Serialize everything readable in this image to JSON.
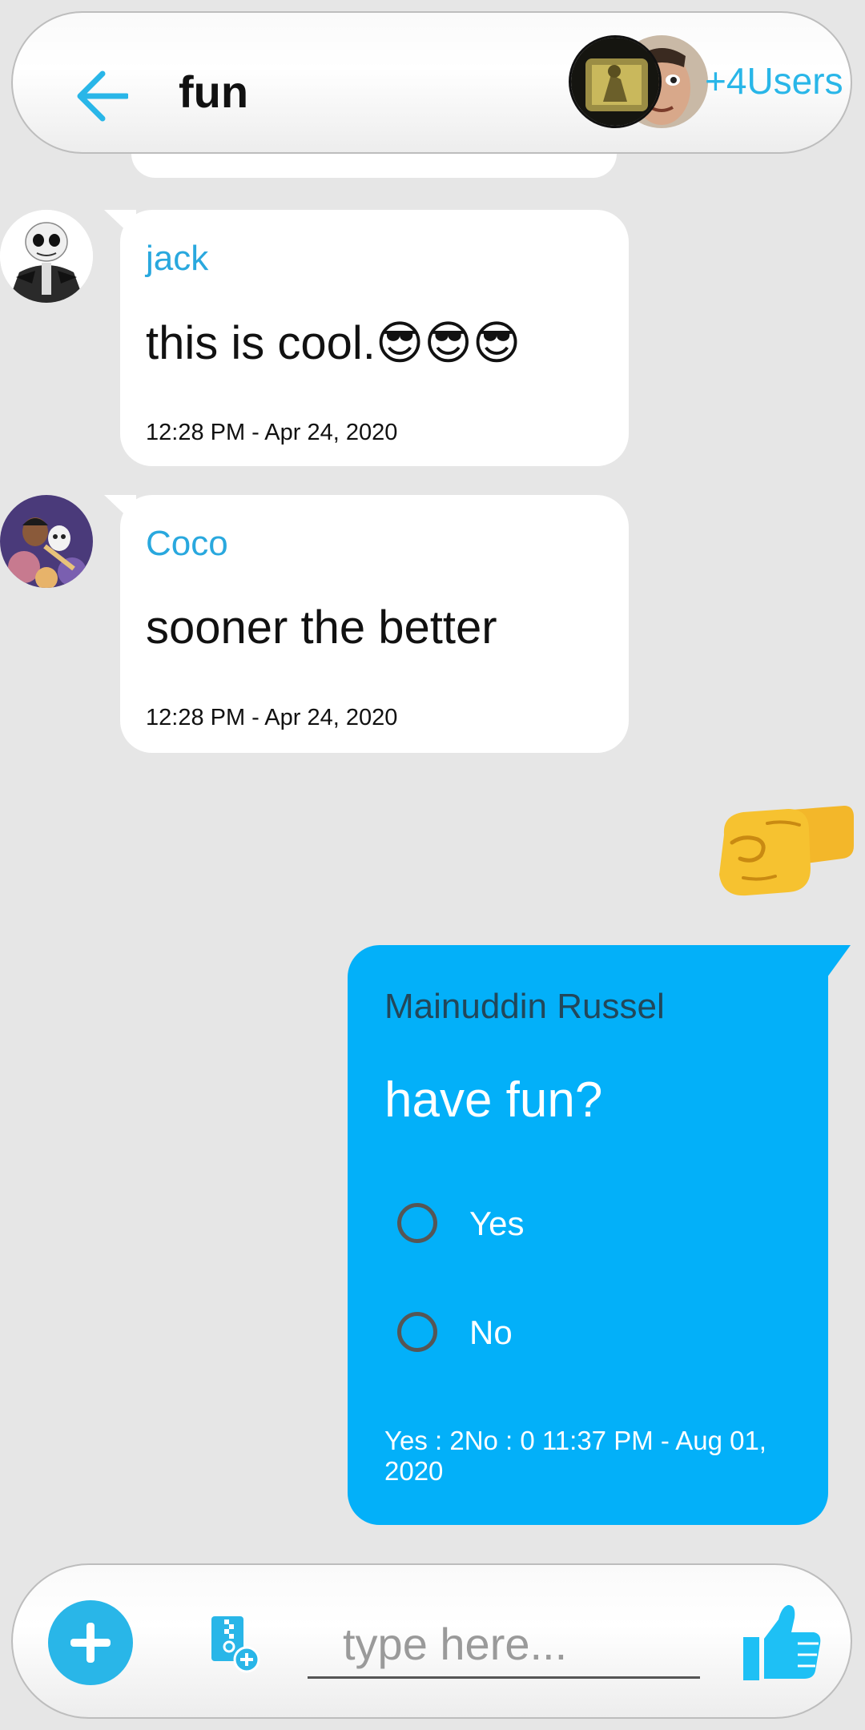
{
  "header": {
    "title": "fun",
    "member_count_label": "+4Users",
    "back_icon": "arrow-left-icon",
    "accent_color": "#29b6e8"
  },
  "messages": [
    {
      "sender": "jack",
      "text": "this is cool.😎😎😎",
      "time": "12:28 PM - Apr 24, 2020",
      "avatar": "skeleton-avatar"
    },
    {
      "sender": "Coco",
      "text": "sooner the better",
      "time": "12:28 PM - Apr 24, 2020",
      "avatar": "coco-avatar"
    }
  ],
  "sticker": {
    "icon": "fist-bump-emoji"
  },
  "poll": {
    "sender": "Mainuddin Russel",
    "question": "have fun?",
    "options": [
      {
        "label": "Yes"
      },
      {
        "label": "No"
      }
    ],
    "footer": "Yes : 2No : 0  11:37 PM - Aug 01, 2020",
    "bubble_color": "#03b0f9"
  },
  "composer": {
    "placeholder": "type here...",
    "value": ""
  }
}
